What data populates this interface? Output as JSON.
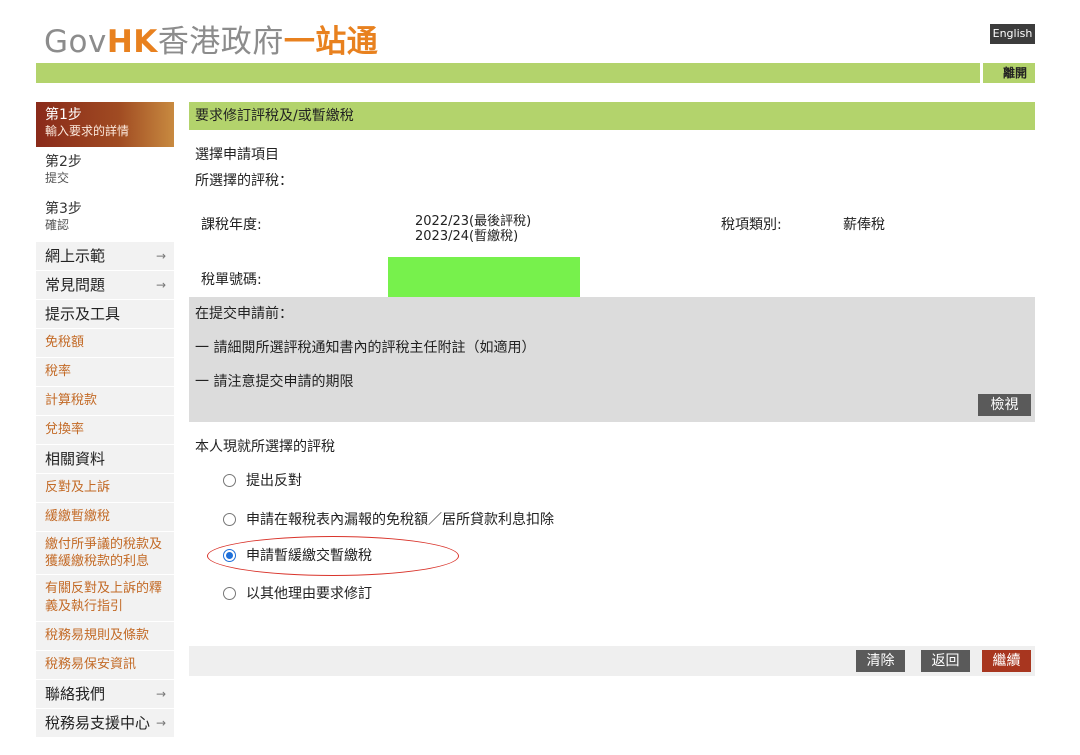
{
  "header": {
    "logo_gov": "Gov",
    "logo_hk": "HK",
    "logo_cn": "香港政府",
    "logo_cn_accent": "一站通",
    "lang_label": "English",
    "exit_label": "離開"
  },
  "sidebar": {
    "steps": [
      {
        "title": "第1步",
        "desc": "輸入要求的詳情"
      },
      {
        "title": "第2步",
        "desc": "提交"
      },
      {
        "title": "第3步",
        "desc": "確認"
      }
    ],
    "nav": {
      "online_demo": "網上示範",
      "faq": "常見問題",
      "tips_tools": "提示及工具",
      "allowances": "免稅額",
      "tax_rates": "稅率",
      "calc_tax": "計算稅款",
      "exchange_rate": "兌換率",
      "related_info": "相關資料",
      "objections": "反對及上訴",
      "holdover": "緩繳暫繳稅",
      "pay_disputed": "繳付所爭議的稅款及獲緩繳稅款的利息",
      "guide": "有關反對及上訴的釋義及執行指引",
      "terms": "稅務易規則及條款",
      "security": "稅務易保安資訊",
      "contact": "聯絡我們",
      "support": "稅務易支援中心"
    }
  },
  "main": {
    "title": "要求修訂評稅及/或暫繳稅",
    "select_item": "選擇申請項目",
    "selected_assessment": "所選擇的評稅：",
    "year_label": "課稅年度:",
    "year_value1": "2022/23(最後評稅)",
    "year_value2": "2023/24(暫繳稅)",
    "type_label": "稅項類別:",
    "type_value": "薪俸稅",
    "tax_no_label": "稅單號碼:",
    "notice": {
      "title": "在提交申請前：",
      "item1": "一  請細閱所選評稅通知書內的評稅主任附註（如適用）",
      "item2": "一  請注意提交申請的期限",
      "view_label": "檢視"
    },
    "choose_label": "本人現就所選擇的評稅",
    "options": [
      {
        "label": "提出反對",
        "checked": false
      },
      {
        "label": "申請在報稅表內漏報的免稅額／居所貸款利息扣除",
        "checked": false
      },
      {
        "label": "申請暫緩繳交暫繳稅",
        "checked": true
      },
      {
        "label": "以其他理由要求修訂",
        "checked": false
      }
    ],
    "buttons": {
      "clear": "清除",
      "back": "返回",
      "continue": "繼續"
    }
  },
  "colors": {
    "green_bar": "#b3d36c",
    "accent_orange": "#e8811f",
    "step_active": "#8a2a1a",
    "link": "#c36a26",
    "continue_btn": "#a8361f",
    "highlight_ring": "#d9342b",
    "redaction": "#77f14c"
  }
}
